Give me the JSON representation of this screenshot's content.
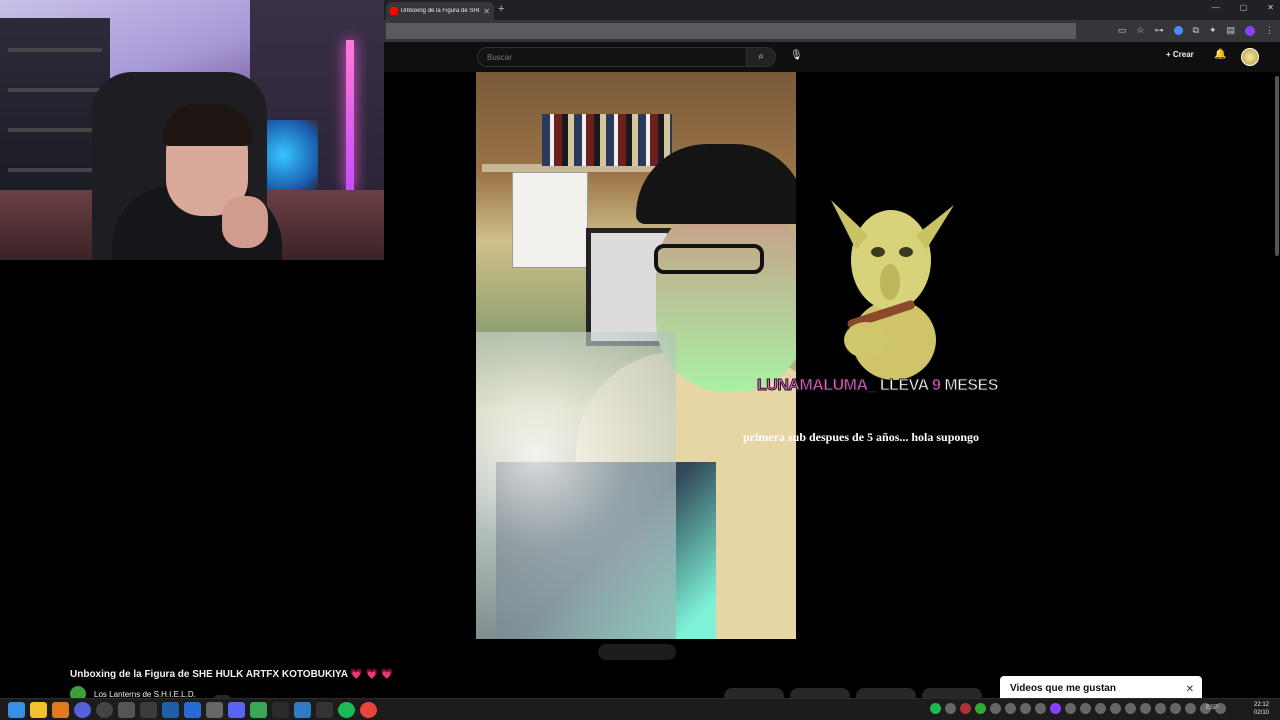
{
  "browser": {
    "tab_title": "Unboxing de la Figura de SHE HULK ARTFX KOTOBUKIYA",
    "tab_close": "✕",
    "new_tab": "+",
    "window_controls": [
      "—",
      "▢",
      "✕"
    ]
  },
  "youtube": {
    "search_placeholder": "Buscar",
    "search_icon": "search-icon",
    "create_label": "+ Crear",
    "video_title": "Unboxing de la Figura de SHE HULK ARTFX KOTOBUKIYA 💗 💗 💗",
    "channel_name": "Los Lanterns de S.H.I.E.L.D.",
    "liked_videos_label": "Videos que me gustan",
    "liked_close": "✕"
  },
  "alert": {
    "username": "LUNAMALUMA_",
    "lleva": "LLEVA",
    "months": "9",
    "meses": "MESES",
    "message": "primera sub despues de 5 años... hola supongo"
  },
  "taskbar": {
    "language": "ESP",
    "time": "22:12",
    "date": "02/10"
  },
  "colors": {
    "alert_pink": "#ff5adf",
    "yt_background": "#0f0f0f"
  }
}
